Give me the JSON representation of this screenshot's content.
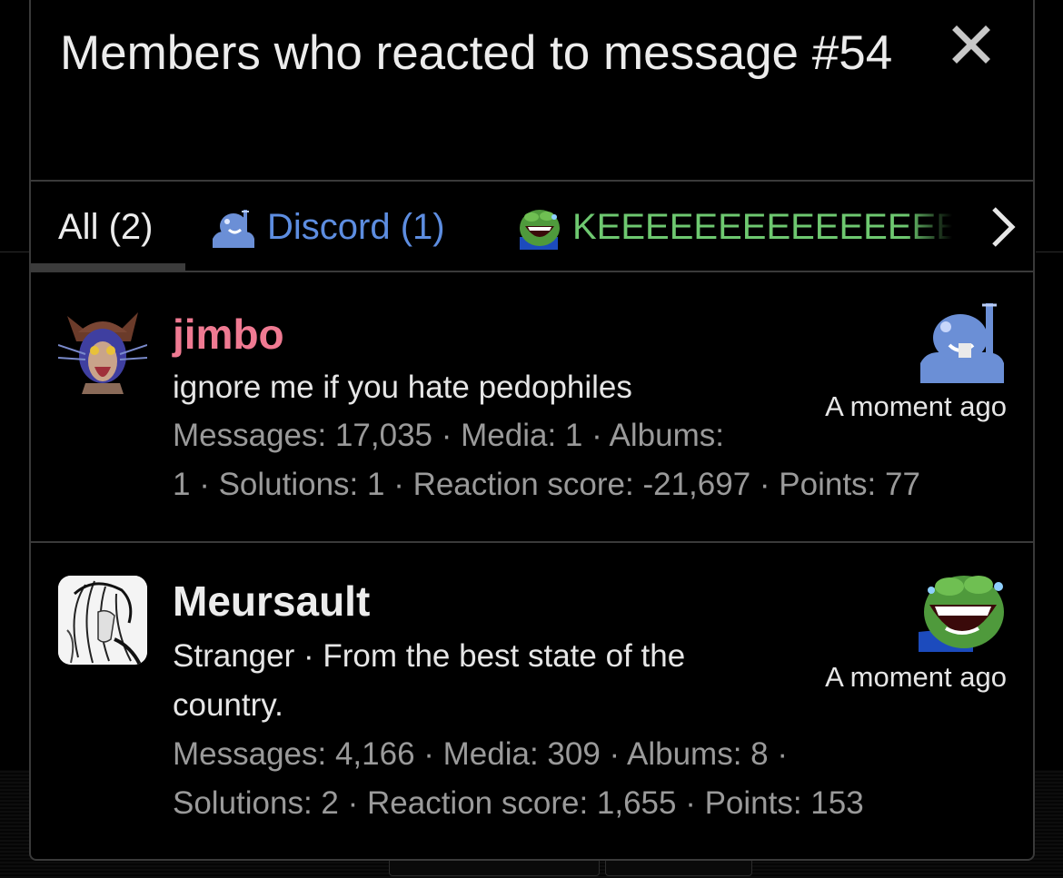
{
  "dialog": {
    "title": "Members who reacted to message #54",
    "close_icon": "close-icon"
  },
  "tabs": [
    {
      "label": "All (2)",
      "active": true
    },
    {
      "label": "Discord (1)",
      "icon": "discord-reaction-icon",
      "color": "#5d8de0"
    },
    {
      "label": "KEEEEEEEEEEEEEEEEE",
      "icon": "pepe-laugh-icon",
      "color": "#6ec870"
    }
  ],
  "tabs_next_icon": "chevron-right-icon",
  "members": [
    {
      "username": "jimbo",
      "username_color": "#ef7a92",
      "user_title": "ignore me if you hate pedophiles",
      "stats_line1": "Messages: 17,035 · Media: 1 · Albums:",
      "stats_line2": "1 · Solutions: 1 · Reaction score: -21,697 · Points: 77",
      "reaction_icon": "discord-reaction-icon",
      "time": "A moment ago"
    },
    {
      "username": "Meursault",
      "username_color": "#ececec",
      "user_title_line1": "Stranger · From the best state of the",
      "user_title_line2": "country.",
      "stats_line1": "Messages: 4,166 · Media: 309 · Albums: 8 ·",
      "stats_line2": "Solutions: 2 · Reaction score: 1,655 · Points: 153",
      "reaction_icon": "pepe-laugh-icon",
      "time": "A moment ago"
    }
  ]
}
